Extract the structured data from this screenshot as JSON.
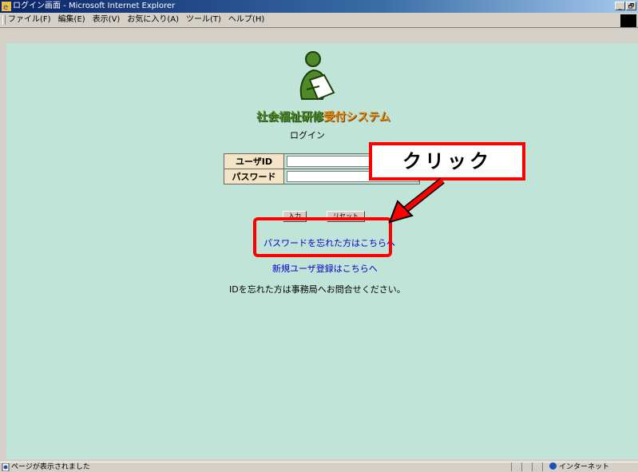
{
  "window": {
    "title": "ログイン画面 - Microsoft Internet Explorer",
    "min_button": "_",
    "max_button": "🗗"
  },
  "menubar": {
    "items": [
      "ファイル(F)",
      "編集(E)",
      "表示(V)",
      "お気に入り(A)",
      "ツール(T)",
      "ヘルプ(H)"
    ]
  },
  "page": {
    "brand_main": "社会福祉研修",
    "brand_sub": "受付システム",
    "login_title": "ログイン",
    "user_id_label": "ユーザID",
    "password_label": "パスワード",
    "user_id_value": "",
    "password_value": "",
    "submit_label": "入力",
    "reset_label": "リセット",
    "forgot_password_link": "パスワードを忘れた方はこちらへ",
    "register_link": "新規ユーザ登録はこちらへ",
    "forgot_id_text": "IDを忘れた方は事務局へお問合せください。"
  },
  "annotation": {
    "callout_text": "クリック",
    "color": "#ff0000"
  },
  "statusbar": {
    "status_text": "ページが表示されました",
    "zone_text": "インターネット"
  }
}
